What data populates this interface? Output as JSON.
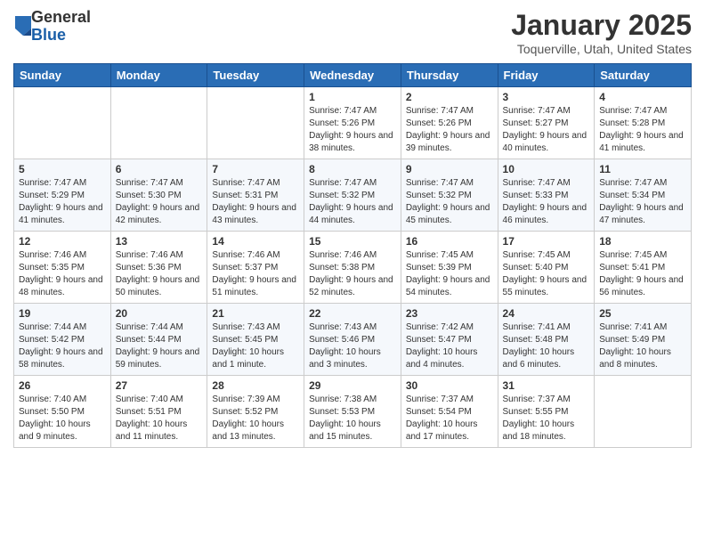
{
  "header": {
    "logo_general": "General",
    "logo_blue": "Blue",
    "month_title": "January 2025",
    "location": "Toquerville, Utah, United States"
  },
  "weekdays": [
    "Sunday",
    "Monday",
    "Tuesday",
    "Wednesday",
    "Thursday",
    "Friday",
    "Saturday"
  ],
  "weeks": [
    [
      {
        "day": "",
        "sunrise": "",
        "sunset": "",
        "daylight": ""
      },
      {
        "day": "",
        "sunrise": "",
        "sunset": "",
        "daylight": ""
      },
      {
        "day": "",
        "sunrise": "",
        "sunset": "",
        "daylight": ""
      },
      {
        "day": "1",
        "sunrise": "Sunrise: 7:47 AM",
        "sunset": "Sunset: 5:26 PM",
        "daylight": "Daylight: 9 hours and 38 minutes."
      },
      {
        "day": "2",
        "sunrise": "Sunrise: 7:47 AM",
        "sunset": "Sunset: 5:26 PM",
        "daylight": "Daylight: 9 hours and 39 minutes."
      },
      {
        "day": "3",
        "sunrise": "Sunrise: 7:47 AM",
        "sunset": "Sunset: 5:27 PM",
        "daylight": "Daylight: 9 hours and 40 minutes."
      },
      {
        "day": "4",
        "sunrise": "Sunrise: 7:47 AM",
        "sunset": "Sunset: 5:28 PM",
        "daylight": "Daylight: 9 hours and 41 minutes."
      }
    ],
    [
      {
        "day": "5",
        "sunrise": "Sunrise: 7:47 AM",
        "sunset": "Sunset: 5:29 PM",
        "daylight": "Daylight: 9 hours and 41 minutes."
      },
      {
        "day": "6",
        "sunrise": "Sunrise: 7:47 AM",
        "sunset": "Sunset: 5:30 PM",
        "daylight": "Daylight: 9 hours and 42 minutes."
      },
      {
        "day": "7",
        "sunrise": "Sunrise: 7:47 AM",
        "sunset": "Sunset: 5:31 PM",
        "daylight": "Daylight: 9 hours and 43 minutes."
      },
      {
        "day": "8",
        "sunrise": "Sunrise: 7:47 AM",
        "sunset": "Sunset: 5:32 PM",
        "daylight": "Daylight: 9 hours and 44 minutes."
      },
      {
        "day": "9",
        "sunrise": "Sunrise: 7:47 AM",
        "sunset": "Sunset: 5:32 PM",
        "daylight": "Daylight: 9 hours and 45 minutes."
      },
      {
        "day": "10",
        "sunrise": "Sunrise: 7:47 AM",
        "sunset": "Sunset: 5:33 PM",
        "daylight": "Daylight: 9 hours and 46 minutes."
      },
      {
        "day": "11",
        "sunrise": "Sunrise: 7:47 AM",
        "sunset": "Sunset: 5:34 PM",
        "daylight": "Daylight: 9 hours and 47 minutes."
      }
    ],
    [
      {
        "day": "12",
        "sunrise": "Sunrise: 7:46 AM",
        "sunset": "Sunset: 5:35 PM",
        "daylight": "Daylight: 9 hours and 48 minutes."
      },
      {
        "day": "13",
        "sunrise": "Sunrise: 7:46 AM",
        "sunset": "Sunset: 5:36 PM",
        "daylight": "Daylight: 9 hours and 50 minutes."
      },
      {
        "day": "14",
        "sunrise": "Sunrise: 7:46 AM",
        "sunset": "Sunset: 5:37 PM",
        "daylight": "Daylight: 9 hours and 51 minutes."
      },
      {
        "day": "15",
        "sunrise": "Sunrise: 7:46 AM",
        "sunset": "Sunset: 5:38 PM",
        "daylight": "Daylight: 9 hours and 52 minutes."
      },
      {
        "day": "16",
        "sunrise": "Sunrise: 7:45 AM",
        "sunset": "Sunset: 5:39 PM",
        "daylight": "Daylight: 9 hours and 54 minutes."
      },
      {
        "day": "17",
        "sunrise": "Sunrise: 7:45 AM",
        "sunset": "Sunset: 5:40 PM",
        "daylight": "Daylight: 9 hours and 55 minutes."
      },
      {
        "day": "18",
        "sunrise": "Sunrise: 7:45 AM",
        "sunset": "Sunset: 5:41 PM",
        "daylight": "Daylight: 9 hours and 56 minutes."
      }
    ],
    [
      {
        "day": "19",
        "sunrise": "Sunrise: 7:44 AM",
        "sunset": "Sunset: 5:42 PM",
        "daylight": "Daylight: 9 hours and 58 minutes."
      },
      {
        "day": "20",
        "sunrise": "Sunrise: 7:44 AM",
        "sunset": "Sunset: 5:44 PM",
        "daylight": "Daylight: 9 hours and 59 minutes."
      },
      {
        "day": "21",
        "sunrise": "Sunrise: 7:43 AM",
        "sunset": "Sunset: 5:45 PM",
        "daylight": "Daylight: 10 hours and 1 minute."
      },
      {
        "day": "22",
        "sunrise": "Sunrise: 7:43 AM",
        "sunset": "Sunset: 5:46 PM",
        "daylight": "Daylight: 10 hours and 3 minutes."
      },
      {
        "day": "23",
        "sunrise": "Sunrise: 7:42 AM",
        "sunset": "Sunset: 5:47 PM",
        "daylight": "Daylight: 10 hours and 4 minutes."
      },
      {
        "day": "24",
        "sunrise": "Sunrise: 7:41 AM",
        "sunset": "Sunset: 5:48 PM",
        "daylight": "Daylight: 10 hours and 6 minutes."
      },
      {
        "day": "25",
        "sunrise": "Sunrise: 7:41 AM",
        "sunset": "Sunset: 5:49 PM",
        "daylight": "Daylight: 10 hours and 8 minutes."
      }
    ],
    [
      {
        "day": "26",
        "sunrise": "Sunrise: 7:40 AM",
        "sunset": "Sunset: 5:50 PM",
        "daylight": "Daylight: 10 hours and 9 minutes."
      },
      {
        "day": "27",
        "sunrise": "Sunrise: 7:40 AM",
        "sunset": "Sunset: 5:51 PM",
        "daylight": "Daylight: 10 hours and 11 minutes."
      },
      {
        "day": "28",
        "sunrise": "Sunrise: 7:39 AM",
        "sunset": "Sunset: 5:52 PM",
        "daylight": "Daylight: 10 hours and 13 minutes."
      },
      {
        "day": "29",
        "sunrise": "Sunrise: 7:38 AM",
        "sunset": "Sunset: 5:53 PM",
        "daylight": "Daylight: 10 hours and 15 minutes."
      },
      {
        "day": "30",
        "sunrise": "Sunrise: 7:37 AM",
        "sunset": "Sunset: 5:54 PM",
        "daylight": "Daylight: 10 hours and 17 minutes."
      },
      {
        "day": "31",
        "sunrise": "Sunrise: 7:37 AM",
        "sunset": "Sunset: 5:55 PM",
        "daylight": "Daylight: 10 hours and 18 minutes."
      },
      {
        "day": "",
        "sunrise": "",
        "sunset": "",
        "daylight": ""
      }
    ]
  ]
}
